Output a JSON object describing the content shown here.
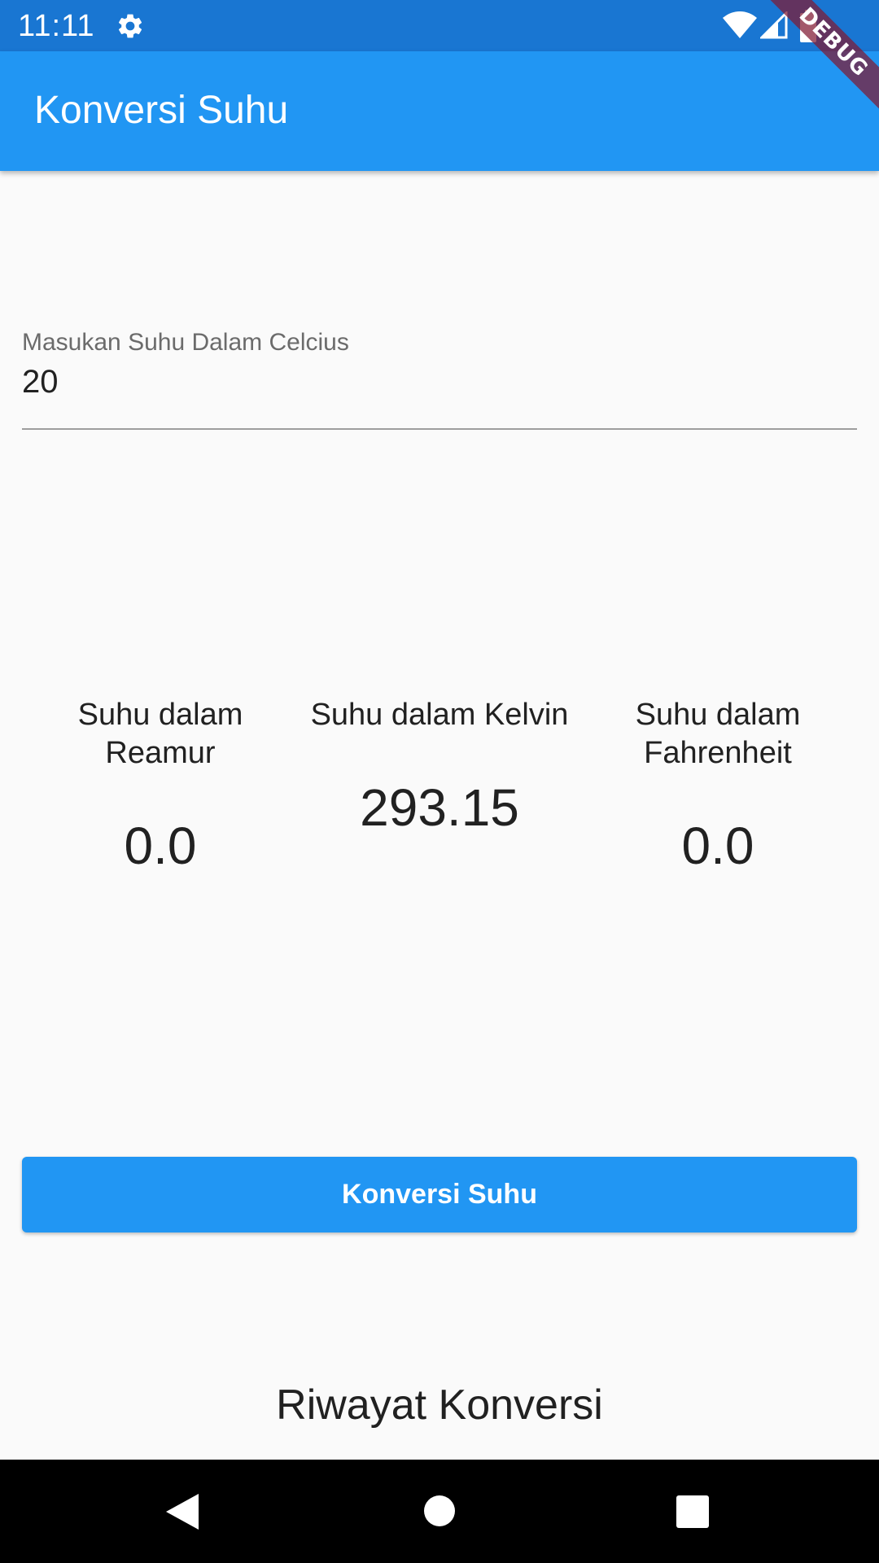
{
  "status_bar": {
    "time": "11:11",
    "icons": [
      "gear-icon",
      "wifi-icon",
      "signal-icon",
      "battery-icon"
    ]
  },
  "app_bar": {
    "title": "Konversi Suhu",
    "color": "#2196F3"
  },
  "debug_banner": {
    "text": "DEBUG"
  },
  "input": {
    "label": "Masukan Suhu Dalam Celcius",
    "value": "20"
  },
  "results": [
    {
      "label": "Suhu dalam Reamur",
      "value": "0.0"
    },
    {
      "label": "Suhu dalam Kelvin",
      "value": "293.15"
    },
    {
      "label": "Suhu dalam Fahrenheit",
      "value": "0.0"
    }
  ],
  "button": {
    "label": "Konversi Suhu"
  },
  "history": {
    "title": "Riwayat Konversi"
  },
  "nav_bar": {
    "icons": [
      "back-icon",
      "home-icon",
      "recent-apps-icon"
    ]
  },
  "colors": {
    "status_bar": "#1976D2",
    "primary": "#2196F3",
    "background": "#FAFAFA",
    "debug_ribbon": "#801932"
  }
}
